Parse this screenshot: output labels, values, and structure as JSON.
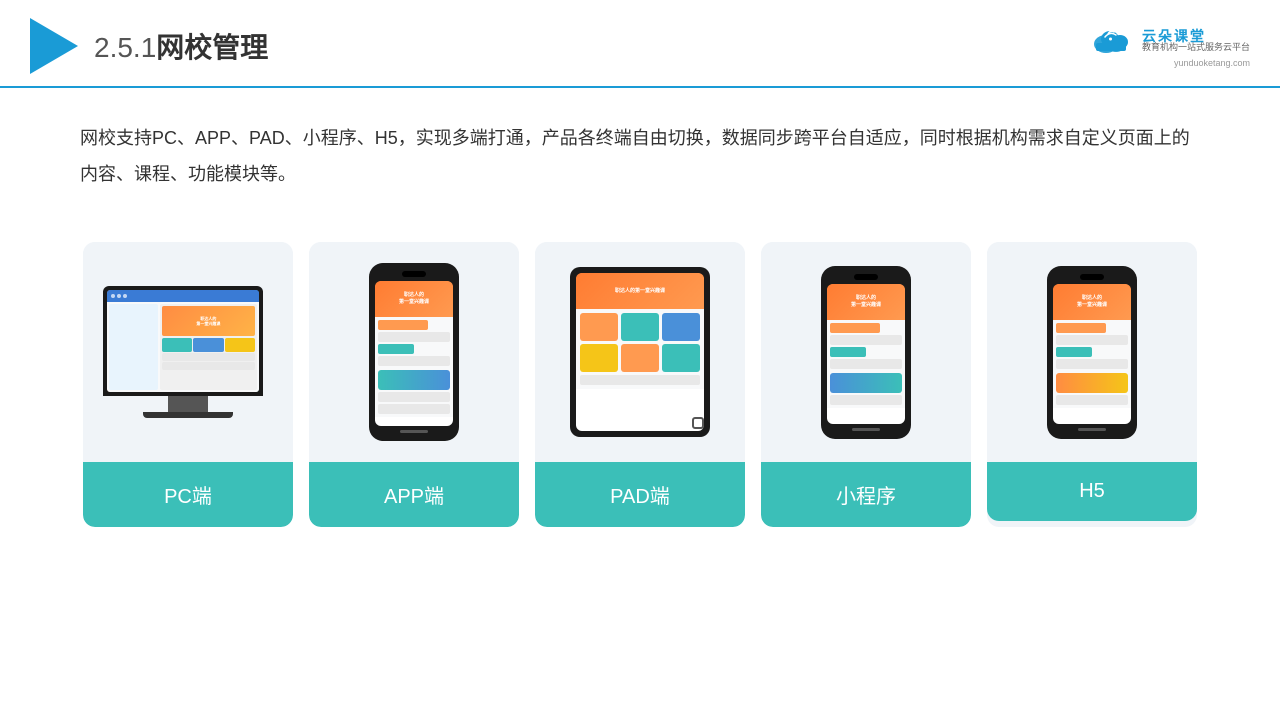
{
  "header": {
    "section_number": "2.5.1",
    "title": "网校管理",
    "brand": {
      "name": "云朵课堂",
      "url": "yunduoketang.com",
      "tagline": "教育机构一站\n式服务云平台"
    }
  },
  "description": "网校支持PC、APP、PAD、小程序、H5，实现多端打通，产品各终端自由切换，数据同步跨平台自适应，同时根据机构需求自定义页面上的内容、课程、功能模块等。",
  "devices": [
    {
      "id": "pc",
      "label": "PC端",
      "type": "pc"
    },
    {
      "id": "app",
      "label": "APP端",
      "type": "phone"
    },
    {
      "id": "pad",
      "label": "PAD端",
      "type": "pad"
    },
    {
      "id": "miniapp",
      "label": "小程序",
      "type": "phone"
    },
    {
      "id": "h5",
      "label": "H5",
      "type": "phone"
    }
  ]
}
